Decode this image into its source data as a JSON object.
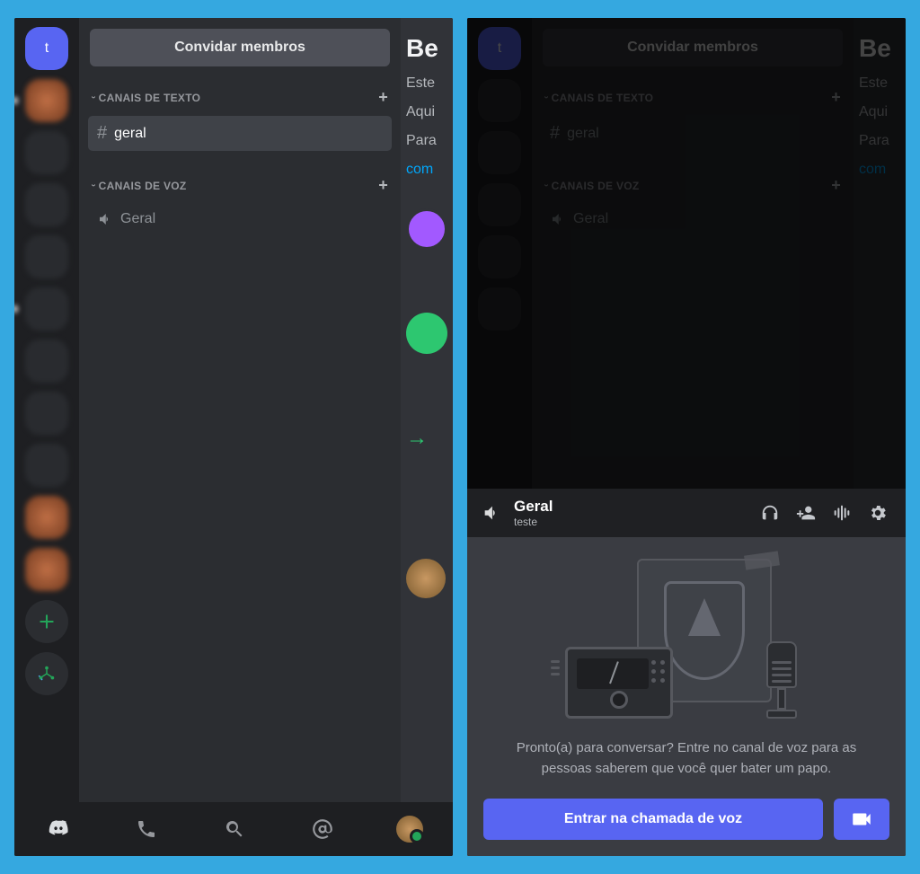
{
  "left": {
    "server_badge": "t",
    "invite_label": "Convidar membros",
    "text_channels_header": "CANAIS DE TEXTO",
    "voice_channels_header": "CANAIS DE VOZ",
    "text_channel_name": "geral",
    "voice_channel_name": "Geral",
    "peek": {
      "title": "Be",
      "line1": "Este",
      "line2": "Aqui",
      "line3": "Para",
      "link": "com"
    }
  },
  "right": {
    "server_badge": "t",
    "invite_label": "Convidar membros",
    "text_channels_header": "CANAIS DE TEXTO",
    "voice_channels_header": "CANAIS DE VOZ",
    "text_channel_name": "geral",
    "voice_channel_name": "Geral",
    "peek": {
      "title": "Be",
      "line1": "Este",
      "line2": "Aqui",
      "line3": "Para",
      "link": "com"
    },
    "voice_panel": {
      "channel": "Geral",
      "server": "teste",
      "prompt": "Pronto(a) para conversar? Entre no canal de voz para as pessoas saberem que você quer bater um papo.",
      "join_label": "Entrar na chamada de voz"
    }
  }
}
